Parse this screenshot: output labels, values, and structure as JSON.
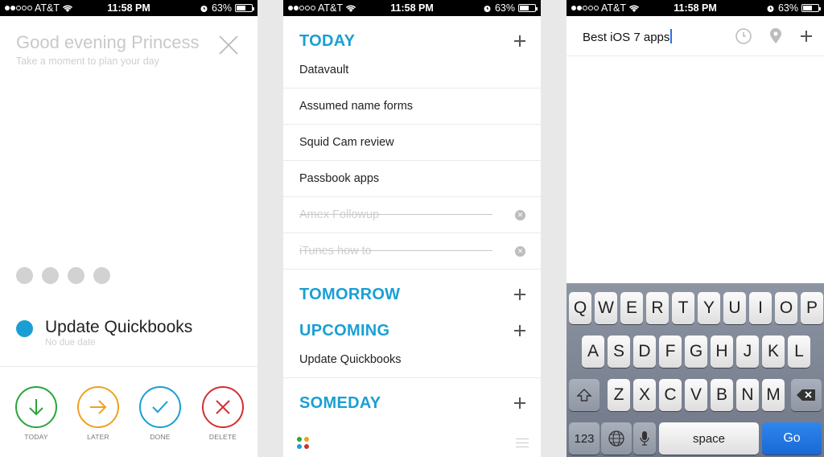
{
  "status_bar": {
    "carrier": "AT&T",
    "time": "11:58 PM",
    "battery": "63%",
    "battery_level": 0.63
  },
  "panel1": {
    "greeting": "Good evening Princess",
    "subtitle": "Take a moment to plan your day",
    "task": "Update Quickbooks",
    "task_due": "No due date",
    "actions": [
      {
        "label": "TODAY",
        "color": "#2aa53b",
        "icon": "arrow-down-icon"
      },
      {
        "label": "LATER",
        "color": "#f0a020",
        "icon": "arrow-right-icon"
      },
      {
        "label": "DONE",
        "color": "#1a9fd4",
        "icon": "check-icon"
      },
      {
        "label": "DELETE",
        "color": "#d32f2f",
        "icon": "x-icon"
      }
    ]
  },
  "panel2": {
    "sections": {
      "today": "TODAY",
      "tomorrow": "TOMORROW",
      "upcoming": "UPCOMING",
      "someday": "SOMEDAY"
    },
    "today_items": [
      "Datavault",
      "Assumed name forms",
      "Squid Cam review",
      "Passbook apps"
    ],
    "done_items": [
      "Amex Followup",
      "iTunes how to"
    ],
    "upcoming_items": [
      "Update Quickbooks"
    ],
    "accent": "#1a9fd4"
  },
  "panel3": {
    "input_value": "Best iOS 7 apps",
    "keyboard": {
      "row1": [
        "Q",
        "W",
        "E",
        "R",
        "T",
        "Y",
        "U",
        "I",
        "O",
        "P"
      ],
      "row2": [
        "A",
        "S",
        "D",
        "F",
        "G",
        "H",
        "J",
        "K",
        "L"
      ],
      "row3": [
        "Z",
        "X",
        "C",
        "V",
        "B",
        "N",
        "M"
      ],
      "numbers": "123",
      "space": "space",
      "go": "Go"
    }
  }
}
